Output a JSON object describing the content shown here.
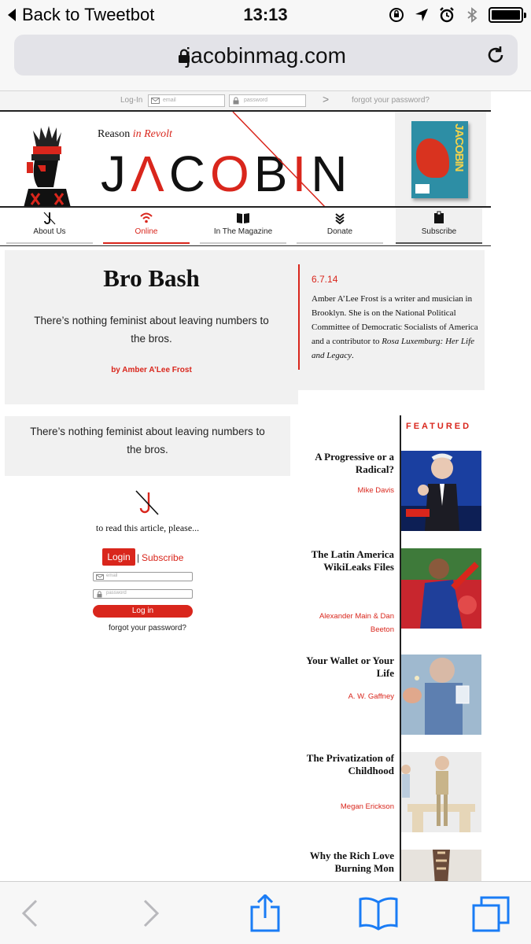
{
  "status_bar": {
    "back_label": "Back to Tweetbot",
    "time": "13:13",
    "icons": [
      "rotation-lock-icon",
      "location-icon",
      "alarm-icon",
      "bluetooth-icon",
      "battery-icon"
    ]
  },
  "address_bar": {
    "url": "jacobinmag.com",
    "icons": [
      "lock-icon",
      "reload-icon"
    ]
  },
  "login_strip": {
    "label": "Log-In",
    "email_placeholder": "email",
    "password_placeholder": "password",
    "submit_glyph": ">",
    "forgot": "forgot your password?"
  },
  "masthead": {
    "tagline_plain": "Reason ",
    "tagline_italic": "in Revolt",
    "logo": "JACOBIN",
    "logo_glyphs": [
      "J",
      "Λ",
      "C",
      "O",
      "B",
      "I",
      "N"
    ],
    "colors": {
      "accent": "#d9261c",
      "ink": "#111111",
      "magazine_cover": "#2d8ea5"
    }
  },
  "nav": {
    "items": [
      {
        "label": "About Us",
        "icon": "jacobin-mark-icon",
        "active": false
      },
      {
        "label": "Online",
        "icon": "wifi-icon",
        "active": true
      },
      {
        "label": "In The Magazine",
        "icon": "book-icon",
        "active": false
      },
      {
        "label": "Donate",
        "icon": "donate-icon",
        "active": false
      },
      {
        "label": "Subscribe",
        "icon": "subscribe-icon",
        "active": false
      }
    ]
  },
  "article": {
    "title": "Bro Bash",
    "dek": "There’s nothing feminist about leaving numbers to the bros.",
    "byline": "by Amber A’Lee Frost",
    "date": "6.7.14",
    "bio": "Amber A’Lee Frost is a writer and musician in Brooklyn. She is on the National Political Committee of Democratic Socialists of America and a contributor to ",
    "bio_book": "Rosa Luxemburg: Her Life and Legacy",
    "bio_end": ".",
    "dek_repeat": "There’s nothing feminist about leaving numbers to the bros."
  },
  "paywall": {
    "prompt": "to read this article, please...",
    "login_label": "Login",
    "separator": "|",
    "subscribe_label": "Subscribe",
    "email_placeholder": "email",
    "password_placeholder": "password",
    "button_label": "Log in",
    "forgot": "forgot your password?"
  },
  "featured": {
    "heading": "FEATURED",
    "items": [
      {
        "title": "A Progressive or a Radical?",
        "author": "Mike Davis"
      },
      {
        "title": "The Latin America WikiLeaks Files",
        "author": "Alexander Main & Dan Beeton"
      },
      {
        "title": "Your Wallet or Your Life",
        "author": "A. W. Gaffney"
      },
      {
        "title": "The Privatization of Childhood",
        "author": "Megan Erickson"
      },
      {
        "title": "Why the Rich Love Burning Mon",
        "author": ""
      }
    ]
  },
  "toolbar": {
    "icons": [
      "back-arrow-icon",
      "forward-arrow-icon",
      "share-icon",
      "bookmarks-icon",
      "tabs-icon"
    ]
  }
}
